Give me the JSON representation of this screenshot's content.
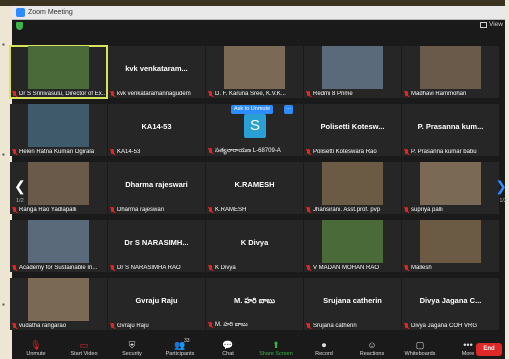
{
  "window": {
    "title": "Zoom Meeting"
  },
  "view_label": "View",
  "pagination": {
    "left": "1/2",
    "right": "1/2"
  },
  "ask_to_unmute": "Ask to Unmute",
  "tiles": [
    {
      "name_big": "",
      "label": "Dr S Srinivasulu, Director of Ex...",
      "type": "video",
      "active": true
    },
    {
      "name_big": "kvk venkataram...",
      "label": "kvk venkataramannagudem",
      "type": "name"
    },
    {
      "name_big": "",
      "label": "D. F. Karuna Sree, K.V.K...",
      "type": "video"
    },
    {
      "name_big": "",
      "label": "Redmi 8 Prime",
      "type": "video"
    },
    {
      "name_big": "",
      "label": "Madhavi Rammohan",
      "type": "video"
    },
    {
      "name_big": "",
      "label": "Helen Ratna Kumari Ogirala",
      "type": "video"
    },
    {
      "name_big": "KA14-53",
      "label": "KA14-53",
      "type": "name"
    },
    {
      "name_big": "",
      "label": "సత్యనారాయణ L-68709-A",
      "type": "avatar",
      "avatar_letter": "S"
    },
    {
      "name_big": "Polisetti Kotesw...",
      "label": "Polisetti Koteswara Rao",
      "type": "name"
    },
    {
      "name_big": "P. Prasanna kum...",
      "label": "P. Prasanna kumar babu",
      "type": "name"
    },
    {
      "name_big": "",
      "label": "Ranga Rao Yadlapalli",
      "type": "video"
    },
    {
      "name_big": "Dharma rajeswari",
      "label": "Dharma rajeswari",
      "type": "name"
    },
    {
      "name_big": "K.RAMESH",
      "label": "K.RAMESH",
      "type": "name"
    },
    {
      "name_big": "",
      "label": "Jhansirani. Asst.prof. pvp",
      "type": "video"
    },
    {
      "name_big": "",
      "label": "supriya palli",
      "type": "video"
    },
    {
      "name_big": "",
      "label": "Academy for Sustainable In...",
      "type": "video"
    },
    {
      "name_big": "Dr S NARASIMH...",
      "label": "Dr S NARASIMHA RAO",
      "type": "name"
    },
    {
      "name_big": "K Divya",
      "label": "K Divya",
      "type": "name"
    },
    {
      "name_big": "",
      "label": "V MADAN MOHAN RAO",
      "type": "video"
    },
    {
      "name_big": "",
      "label": "Mallesh",
      "type": "video"
    },
    {
      "name_big": "",
      "label": "vudatha rangarao",
      "type": "video"
    },
    {
      "name_big": "Gvraju Raju",
      "label": "Gvraju Raju",
      "type": "name"
    },
    {
      "name_big": "M. హరి బాబు",
      "label": "M. హరి బాబు",
      "type": "name"
    },
    {
      "name_big": "Srujana catherin",
      "label": "Srujana catherin",
      "type": "name"
    },
    {
      "name_big": "Divya Jagana C...",
      "label": "Divya Jagana COH VRG",
      "type": "name"
    }
  ],
  "toolbar": {
    "unmute": "Unmute",
    "start_video": "Start Video",
    "security": "Security",
    "participants": "Participants",
    "participants_count": "33",
    "chat": "Chat",
    "share_screen": "Share Screen",
    "record": "Record",
    "reactions": "Reactions",
    "whiteboards": "Whiteboards",
    "more": "More",
    "end": "End"
  },
  "colors": {
    "accent": "#2d8cff",
    "share": "#39b54a",
    "end": "#e02828",
    "active_border": "#d7e35a"
  }
}
